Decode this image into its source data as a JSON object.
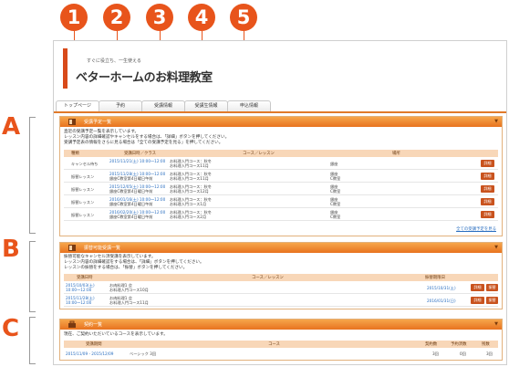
{
  "callouts": [
    "1",
    "2",
    "3",
    "4",
    "5"
  ],
  "sections": [
    "A",
    "B",
    "C"
  ],
  "colors": {
    "accent": "#e8541b",
    "panel_header": "#ef8a30",
    "table_header": "#f8d7b8",
    "button": "#c9531e",
    "link": "#2a6ec0"
  },
  "logo": {
    "tagline": "すぐに役立ち、一生使える",
    "name": "ベターホームのお料理教室"
  },
  "tabs": [
    "トップページ",
    "予約",
    "受講情報",
    "受講生情報",
    "申込情報"
  ],
  "panel_a": {
    "title": "受講予定一覧",
    "desc": [
      "直近の受講予定一覧を表示しています。",
      "レッスン内容の詳細確認やキャンセルをする場合は、「詳細」ボタンを押してください。",
      "受講予定表の情報をさらに見る場合は「全ての受講予定を見る」を押してください。"
    ],
    "headers": [
      "種類",
      "受講日時／クラス",
      "コース／レッスン",
      "場所"
    ],
    "rows": [
      {
        "type": "キャンセル待ち",
        "date": "2015/11/21(土) 10:00～12:00",
        "class": "",
        "course": "お料理入門コース：秋冬",
        "lesson": "お料理入門コース11月",
        "place": "銀座",
        "room": "",
        "btn": "詳細"
      },
      {
        "type": "振替レッスン",
        "date": "2015/11/28(土) 10:00～12:00",
        "class": "銀座C教室第4日曜日午前",
        "course": "お料理入門コース：秋冬",
        "lesson": "お料理入門コース11月",
        "place": "銀座",
        "room": "C教室",
        "btn": "詳細"
      },
      {
        "type": "振替レッスン",
        "date": "2015/12/05(土) 10:00～12:00",
        "class": "銀座C教室第4日曜日午前",
        "course": "お料理入門コース：秋冬",
        "lesson": "お料理入門コース12月",
        "place": "銀座",
        "room": "C教室",
        "btn": "詳細"
      },
      {
        "type": "振替レッスン",
        "date": "2016/01/16(土) 10:00～12:00",
        "class": "銀座C教室第4日曜日午前",
        "course": "お料理入門コース：秋冬",
        "lesson": "お料理入門コース1月",
        "place": "銀座",
        "room": "C教室",
        "btn": "詳細"
      },
      {
        "type": "振替レッスン",
        "date": "2016/02/20(土) 10:00～12:00",
        "class": "銀座C教室第4日曜日午前",
        "course": "お料理入門コース：秋冬",
        "lesson": "お料理入門コース2月",
        "place": "銀座",
        "room": "C教室",
        "btn": "詳細"
      }
    ],
    "more_link": "全ての受講予定を見る"
  },
  "panel_b": {
    "title": "振替可能受講一覧",
    "desc": [
      "振替可能なキャンセル済受講を表示しています。",
      "レッスン内容の詳細確認をする場合は、「詳細」ボタンを押してください。",
      "レッスンの振替をする場合は、「振替」ボタンを押してください。"
    ],
    "headers": [
      "受講日時",
      "コース／レッスン",
      "振替期限日"
    ],
    "rows": [
      {
        "date": "2015/10/03(土)",
        "time": "10:00～12:00",
        "course": "お肉料理1 会",
        "lesson": "お料理入門コース10月",
        "deadline": "2015/10/31(土)",
        "btn1": "詳細",
        "btn2": "振替"
      },
      {
        "date": "2015/11/28(土)",
        "time": "10:00～12:00",
        "course": "お肉料理1 会",
        "lesson": "お料理入門コース11月",
        "deadline": "2016/01/31(日)",
        "btn1": "詳細",
        "btn2": "振替"
      }
    ]
  },
  "panel_c": {
    "title": "契約一覧",
    "desc": [
      "現在、ご契約いただいているコースを表示しています。"
    ],
    "headers": [
      "受講期間",
      "コース",
      "契約数",
      "予約済数",
      "残数"
    ],
    "rows": [
      {
        "period": "2015/11/09 - 2015/12/09",
        "course": "ベーシック 3回",
        "contracted": "3回",
        "reserved": "0回",
        "remaining": "3回"
      }
    ]
  }
}
